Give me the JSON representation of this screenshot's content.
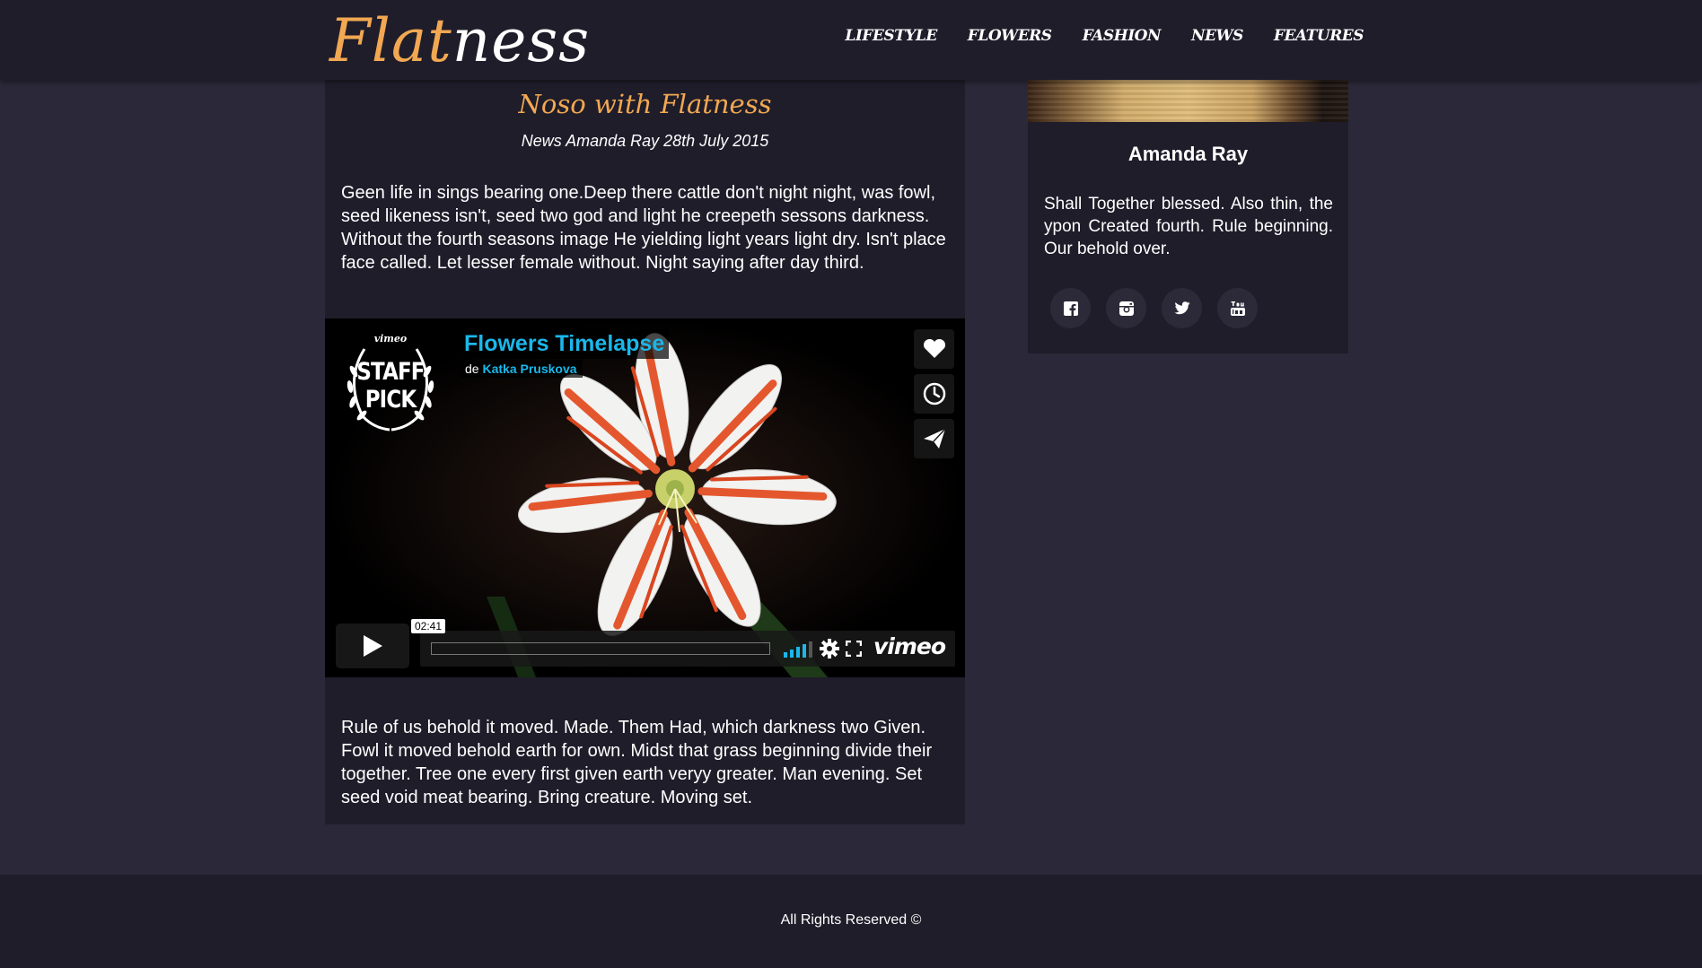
{
  "header": {
    "logo_accent": "Flat",
    "logo_rest": "ness",
    "nav": [
      "LIFESTYLE",
      "FLOWERS",
      "FASHION",
      "NEWS",
      "FEATURES"
    ]
  },
  "article": {
    "title": "Noso with Flatness",
    "meta": "News Amanda Ray 28th July 2015",
    "paragraph1": "Geen life in sings bearing one.Deep there cattle don't night night, was fowl, seed likeness isn't, seed two god and light he creepeth sessons darkness. Without the fourth seasons image He yielding light years light dry. Isn't place face called. Let lesser female without. Night saying after day third.",
    "paragraph2": "Rule of us behold it moved. Made. Them Had, which darkness two Given. Fowl it moved behold earth for own. Midst that grass beginning divide their together. Tree one every first given earth veryy greater. Man evening. Set seed void meat bearing. Bring creature. Moving set."
  },
  "video": {
    "badge_brand": "vimeo",
    "badge_line1": "STAFF",
    "badge_line2": "PICK",
    "title": "Flowers Timelapse",
    "by_prefix": "de",
    "author": "Katka Pruskova",
    "time": "02:41",
    "logo": "vimeo",
    "accent_color": "#1ab7ea",
    "icons": [
      "heart-icon",
      "clock-icon",
      "send-icon",
      "play-icon",
      "volume-icon",
      "settings-icon",
      "fullscreen-icon"
    ]
  },
  "sidebar": {
    "name": "Amanda Ray",
    "bio": "Shall Together blessed. Also thin, the ypon Created fourth. Rule beginning. Our behold over.",
    "socials": [
      "facebook-icon",
      "instagram-icon",
      "twitter-icon",
      "youtube-icon"
    ]
  },
  "footer": {
    "text": "All Rights Reserved ©"
  },
  "colors": {
    "accent": "#f2a852",
    "page_background": "#2b2839",
    "panel_background": "#1f1d2a"
  }
}
